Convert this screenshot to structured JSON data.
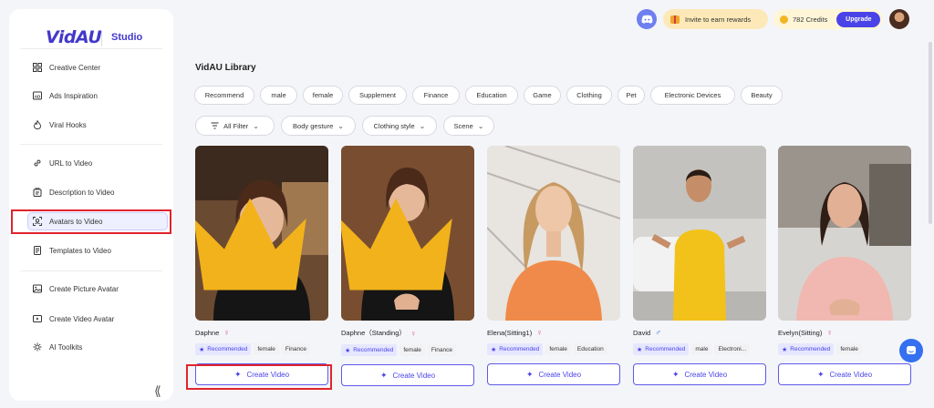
{
  "brand": {
    "logo": "VidAU",
    "product": "Studio"
  },
  "sidebar": {
    "items": [
      {
        "label": "Creative Center",
        "icon": "grid-icon"
      },
      {
        "label": "Ads Inspiration",
        "icon": "ad-icon"
      },
      {
        "label": "Viral Hooks",
        "icon": "flame-icon"
      },
      {
        "label": "URL to Video",
        "icon": "link-icon"
      },
      {
        "label": "Description to Video",
        "icon": "document-icon"
      },
      {
        "label": "Avatars to Video",
        "icon": "avatar-scan-icon",
        "active": true
      },
      {
        "label": "Templates to Video",
        "icon": "template-icon"
      },
      {
        "label": "Create Picture Avatar",
        "icon": "image-icon"
      },
      {
        "label": "Create Video Avatar",
        "icon": "video-icon"
      },
      {
        "label": "AI Toolkits",
        "icon": "sun-icon"
      }
    ],
    "collapse_icon": "double-chevron-left-icon"
  },
  "topbar": {
    "invite_label": "Invite to earn rewards",
    "credits_label": "782 Credits",
    "upgrade_label": "Upgrade"
  },
  "library": {
    "title": "VidAU Library",
    "tags": [
      "Recommend",
      "male",
      "female",
      "Supplement",
      "Finance",
      "Education",
      "Game",
      "Clothing",
      "Pet",
      "Electronic Devices",
      "Beauty"
    ],
    "filters": [
      "All Filter",
      "Body gesture",
      "Clothing style",
      "Scene"
    ]
  },
  "avatars": [
    {
      "name": "Daphne",
      "gender": "female",
      "chips": [
        "Recommended",
        "female",
        "Finance"
      ],
      "premium": true,
      "button": "Create Video"
    },
    {
      "name": "Daphne（Standing）",
      "gender": "female",
      "chips": [
        "Recommended",
        "female",
        "Finance"
      ],
      "premium": true,
      "button": "Create Video"
    },
    {
      "name": "Elena(Sitting1)",
      "gender": "female",
      "chips": [
        "Recommended",
        "female",
        "Education"
      ],
      "premium": false,
      "button": "Create Video"
    },
    {
      "name": "David",
      "gender": "male",
      "chips": [
        "Recommended",
        "male",
        "Electroni..."
      ],
      "premium": false,
      "button": "Create Video"
    },
    {
      "name": "Evelyn(Sitting)",
      "gender": "female",
      "chips": [
        "Recommended",
        "female"
      ],
      "premium": false,
      "button": "Create Video"
    }
  ],
  "colors": {
    "accent": "#4a43e8",
    "highlight": "#e0242c",
    "female": "#e0468e",
    "male": "#3a6be0"
  }
}
